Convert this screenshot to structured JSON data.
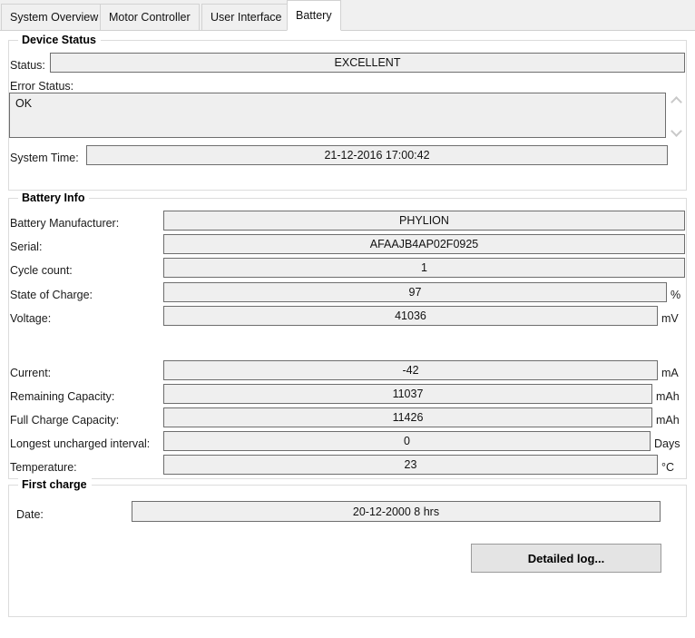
{
  "tabs": [
    {
      "label": "System Overview",
      "active": false
    },
    {
      "label": "Motor Controller",
      "active": false
    },
    {
      "label": "User Interface",
      "active": false
    },
    {
      "label": "Battery",
      "active": true
    }
  ],
  "device_status": {
    "title": "Device Status",
    "status_label": "Status:",
    "status_value": "EXCELLENT",
    "error_status_label": "Error Status:",
    "error_status_value": "OK",
    "system_time_label": "System Time:",
    "system_time_value": "21-12-2016 17:00:42"
  },
  "battery_info": {
    "title": "Battery Info",
    "rows": [
      {
        "label": "Battery Manufacturer:",
        "value": "PHYLION",
        "unit": ""
      },
      {
        "label": "Serial:",
        "value": "AFAAJB4AP02F0925",
        "unit": ""
      },
      {
        "label": "Cycle count:",
        "value": "1",
        "unit": ""
      },
      {
        "label": "State of Charge:",
        "value": "97",
        "unit": "%"
      },
      {
        "label": "Voltage:",
        "value": "41036",
        "unit": "mV"
      },
      {
        "label": "Current:",
        "value": "-42",
        "unit": "mA"
      },
      {
        "label": "Remaining Capacity:",
        "value": "11037",
        "unit": "mAh"
      },
      {
        "label": "Full Charge Capacity:",
        "value": "11426",
        "unit": "mAh"
      },
      {
        "label": "Longest uncharged interval:",
        "value": "0",
        "unit": "Days"
      },
      {
        "label": "Temperature:",
        "value": "23",
        "unit": "°C"
      }
    ]
  },
  "first_charge": {
    "title": "First charge",
    "date_label": "Date:",
    "date_value": "20-12-2000  8 hrs",
    "detailed_log_label": "Detailed log..."
  },
  "colors": {
    "field_bg": "#efefef",
    "field_border": "#6e6e6e",
    "tabstrip_bg": "#f0f0f0",
    "group_border": "#dcdcdc",
    "button_bg": "#e4e4e4"
  }
}
